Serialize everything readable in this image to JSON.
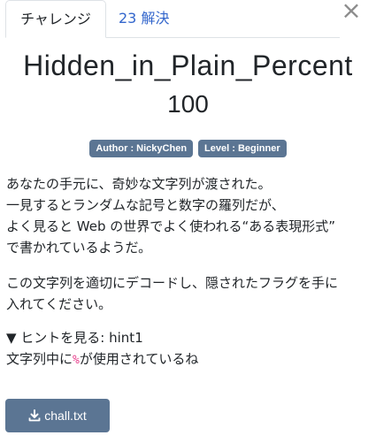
{
  "tabs": {
    "challenge": "チャレンジ",
    "solves": "23 解決"
  },
  "close_icon": "×",
  "challenge": {
    "name": "Hidden_in_Plain_Percent",
    "points": "100",
    "author_badge": "Author : NickyChen",
    "level_badge": "Level : Beginner"
  },
  "description": {
    "line1": "あなたの手元に、奇妙な文字列が渡された。",
    "line2": "一見するとランダムな記号と数字の羅列だが、",
    "line3": "よく見ると Web の世界でよく使われる“ある表現形式”",
    "line4": "で書かれているようだ。",
    "para2_line1": "この文字列を適切にデコードし、隠されたフラグを手に",
    "para2_line2": "入れてください。"
  },
  "hint": {
    "summary": "▼ ヒントを見る: hint1",
    "body_before": "文字列中に",
    "code": "%",
    "body_after": "が使用されているね"
  },
  "files": {
    "download_label": "chall.txt"
  },
  "colors": {
    "badge": "#5b7593",
    "tab_link": "#3366cc",
    "code": "#e83e8c",
    "button": "#5b7593"
  }
}
